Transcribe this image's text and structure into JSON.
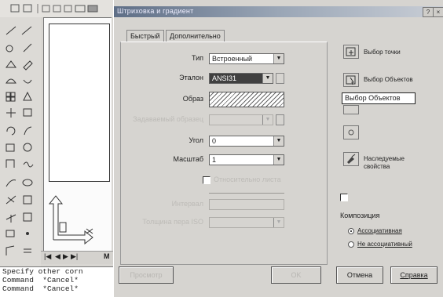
{
  "dialog": {
    "title": "Штриховка и градиент",
    "help": "?",
    "close": "×",
    "tabs": [
      "Быстрый",
      "Дополнительно"
    ],
    "fields": {
      "type_label": "Тип",
      "type_value": "Встроенный",
      "pattern_label": "Эталон",
      "pattern_value": "ANSI31",
      "swatch_label": "Образ",
      "custom_label": "Задаваемый образец",
      "angle_label": "Угол",
      "angle_value": "0",
      "scale_label": "Масштаб",
      "scale_value": "1",
      "relative_label": "Относительно листа",
      "spacing_label": "Интервал",
      "iso_label": "Толщина пера ISO"
    },
    "right": {
      "pick_points": "Выбор точки",
      "select_objects": "Выбор Объектов",
      "inherit": "Наследуемые свойства",
      "composition_title": "Композиция",
      "associative": "Ассоциативная",
      "non_associative": "Не ассоциативный"
    },
    "tooltip": "Выбор Объектов",
    "buttons": {
      "preview": "Просмотр",
      "ok": "OK",
      "cancel": "Отмена",
      "help": "Справка"
    }
  },
  "background": {
    "command_lines": [
      "Specify other corn",
      "Command  *Cancel*",
      "Command  *Cancel*"
    ],
    "nav": [
      "|◀",
      "◀",
      "▶",
      "▶|",
      "M"
    ]
  },
  "colors": {
    "title_start": "#5e6e86",
    "title_end": "#c9ced6",
    "dialog_bg": "#d6d4d0"
  }
}
